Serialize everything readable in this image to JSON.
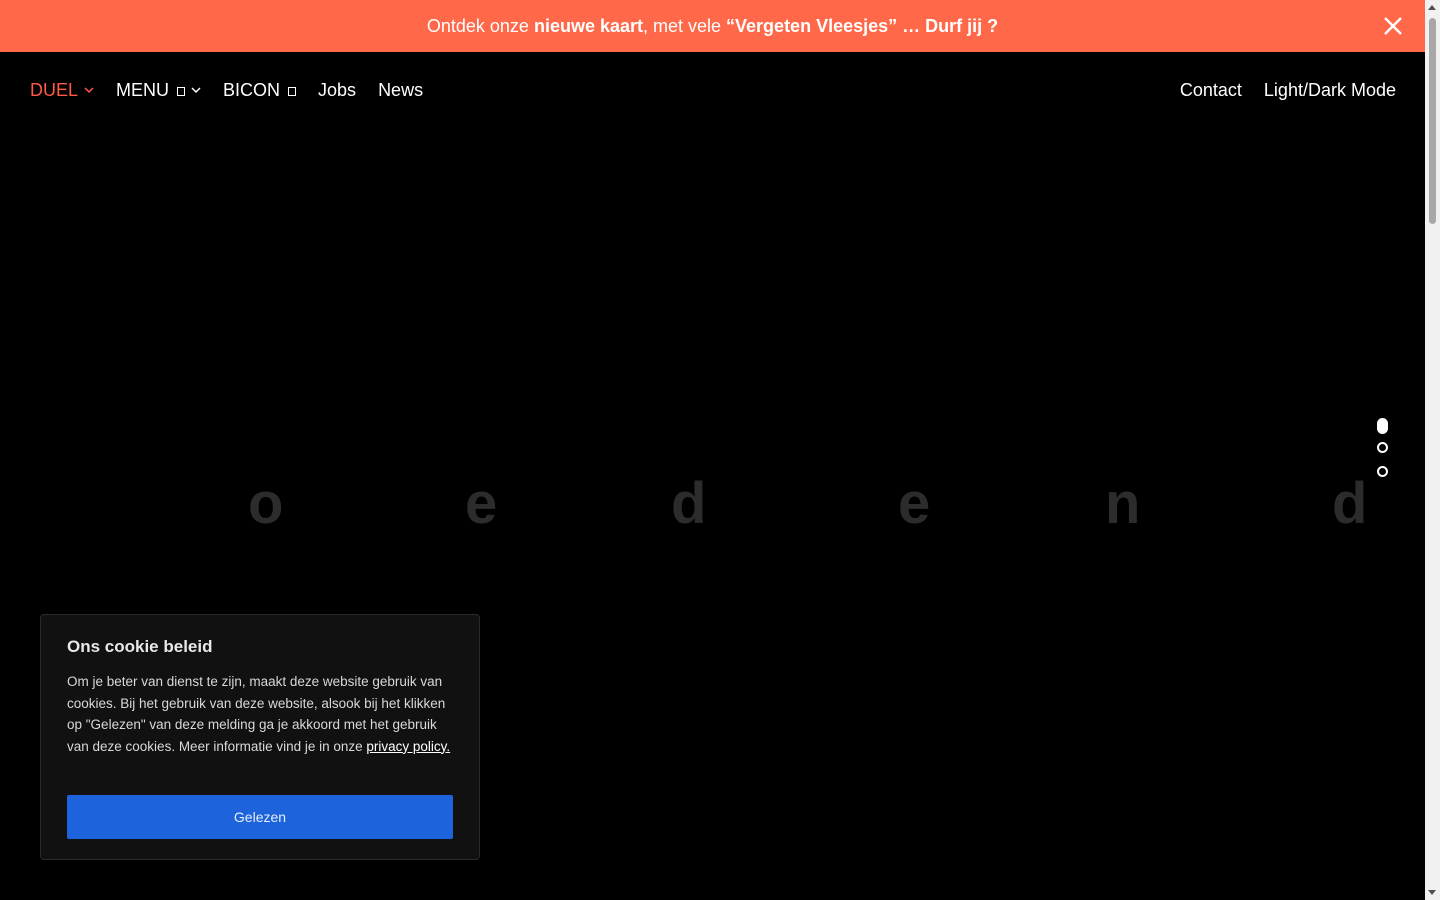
{
  "banner": {
    "text_1": "Ontdek onze ",
    "text_bold_1": "nieuwe kaart",
    "text_2": ", met vele ",
    "text_bold_2": "“Vergeten Vleesjes” … Durf jij ?",
    "close_icon": "close-icon",
    "color": "#ff6849"
  },
  "nav": {
    "left": [
      {
        "label": "DUEL",
        "active": true
      },
      {
        "label": "MENU"
      },
      {
        "label": "BICON"
      },
      {
        "label": "Jobs"
      },
      {
        "label": "News"
      }
    ],
    "right": [
      {
        "label": "Contact"
      },
      {
        "label": "Light/Dark Mode"
      }
    ],
    "accent": "#ff5a45"
  },
  "hero": {
    "letters": [
      "o",
      "e",
      "d",
      "e",
      "n",
      "d"
    ]
  },
  "slider": {
    "count": 3,
    "active_index": 0
  },
  "cookie": {
    "title": "Ons cookie beleid",
    "body": "Om je beter van dienst te zijn, maakt deze website gebruik van cookies. Bij het gebruik van deze website, alsook bij het klikken op \"Gelezen\" van deze melding ga je akkoord met het gebruik van deze cookies. Meer informatie vind je in onze ",
    "link": "privacy policy.",
    "button": "Gelezen",
    "button_color": "#1d63dc"
  }
}
